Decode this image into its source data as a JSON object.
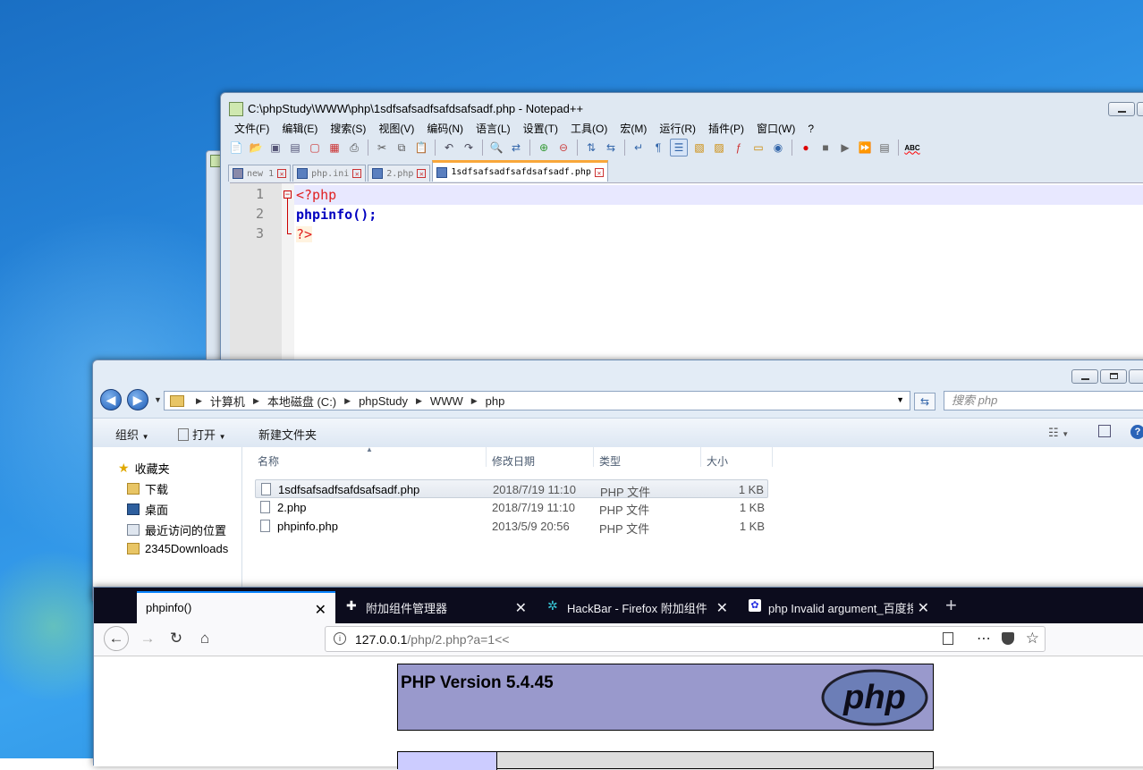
{
  "notepadpp": {
    "title": "C:\\phpStudy\\WWW\\php\\1sdfsafsadfsafdsafsadf.php - Notepad++",
    "menu": [
      "文件(F)",
      "编辑(E)",
      "搜索(S)",
      "视图(V)",
      "编码(N)",
      "语言(L)",
      "设置(T)",
      "工具(O)",
      "宏(M)",
      "运行(R)",
      "插件(P)",
      "窗口(W)",
      "?"
    ],
    "tabs": [
      {
        "label": "new 1",
        "active": false
      },
      {
        "label": "php.ini",
        "active": false
      },
      {
        "label": "2.php",
        "active": false
      },
      {
        "label": "1sdfsafsadfsafdsafsadf.php",
        "active": true
      }
    ],
    "lines": [
      {
        "num": "1",
        "text": "<?php"
      },
      {
        "num": "2",
        "text": "phpinfo();"
      },
      {
        "num": "3",
        "text": "?>"
      }
    ],
    "toolbar_abc": "ABC"
  },
  "explorer": {
    "breadcrumb": [
      "计算机",
      "本地磁盘 (C:)",
      "phpStudy",
      "WWW",
      "php"
    ],
    "search_placeholder": "搜索 php",
    "commands": {
      "organize": "组织",
      "open": "打开",
      "new_folder": "新建文件夹"
    },
    "nav": [
      {
        "label": "收藏夹",
        "icon": "star-icon"
      },
      {
        "label": "下载",
        "icon": "download-folder-icon"
      },
      {
        "label": "桌面",
        "icon": "desktop-icon"
      },
      {
        "label": "最近访问的位置",
        "icon": "recent-places-icon"
      },
      {
        "label": "2345Downloads",
        "icon": "folder-icon"
      }
    ],
    "columns": {
      "name": "名称",
      "modified": "修改日期",
      "type": "类型",
      "size": "大小"
    },
    "files": [
      {
        "name": "1sdfsafsadfsafdsafsadf.php",
        "modified": "2018/7/19 11:10",
        "type": "PHP 文件",
        "size": "1 KB",
        "selected": true
      },
      {
        "name": "2.php",
        "modified": "2018/7/19 11:10",
        "type": "PHP 文件",
        "size": "1 KB",
        "selected": false
      },
      {
        "name": "phpinfo.php",
        "modified": "2013/5/9 20:56",
        "type": "PHP 文件",
        "size": "1 KB",
        "selected": false
      }
    ]
  },
  "firefox": {
    "tabs": [
      {
        "label": "phpinfo()",
        "active": true,
        "icon": ""
      },
      {
        "label": "附加组件管理器",
        "active": false,
        "icon": "puzzle-icon"
      },
      {
        "label": "HackBar - Firefox 附加组件",
        "active": false,
        "icon": "hackbar-icon"
      },
      {
        "label": "php Invalid argument_百度搜",
        "active": false,
        "icon": "baidu-paw-icon"
      }
    ],
    "url_host": "127.0.0.1",
    "url_path": "/php/2.php?a=1<<",
    "page": {
      "heading": "PHP Version 5.4.45",
      "logo_text": "php"
    }
  },
  "colors": {
    "desktop": "#2a8be0",
    "php_header": "#9999cc",
    "firefox_tabbar": "#0c0c1d",
    "firefox_accent": "#0a84ff",
    "npp_active_tab": "#f9a73a"
  }
}
